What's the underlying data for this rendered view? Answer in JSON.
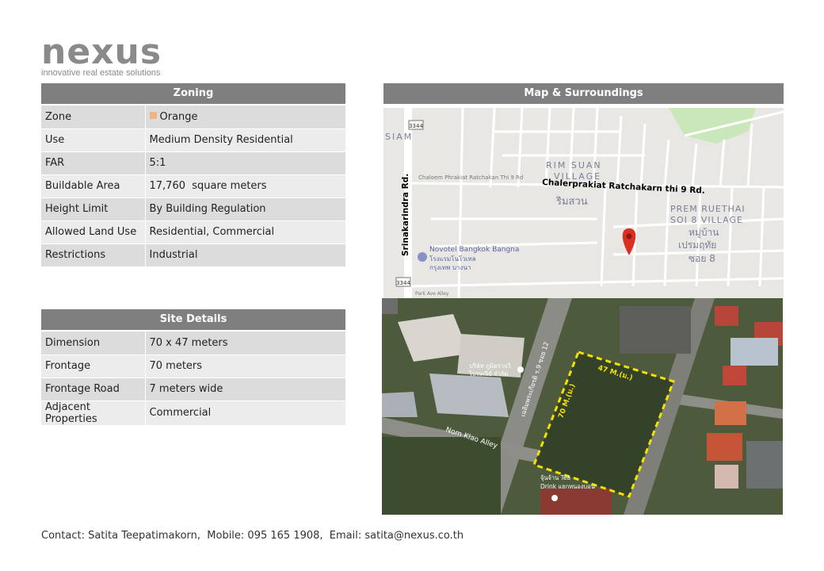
{
  "logo": {
    "word": "nexus",
    "tagline": "innovative real estate solutions"
  },
  "zoning": {
    "title": "Zoning",
    "rows": [
      {
        "key": "Zone",
        "value": "Orange"
      },
      {
        "key": "Use",
        "value": "Medium Density Residential"
      },
      {
        "key": "FAR",
        "value": "5:1"
      },
      {
        "key": "Buildable Area",
        "value": "17,760  square meters"
      },
      {
        "key": "Height Limit",
        "value": "By Building Regulation"
      },
      {
        "key": "Allowed Land Use",
        "value": "Residential, Commercial"
      },
      {
        "key": "Restrictions",
        "value": "Industrial"
      }
    ],
    "zone_color": "#f4b183"
  },
  "site": {
    "title": "Site Details",
    "rows": [
      {
        "key": "Dimension",
        "value": "70 x 47 meters"
      },
      {
        "key": "Frontage",
        "value": "70 meters"
      },
      {
        "key": "Frontage Road",
        "value": "7 meters wide"
      },
      {
        "key": "Adjacent Properties",
        "value": "Commercial"
      }
    ]
  },
  "map": {
    "title": "Map & Surroundings",
    "labels": {
      "srinakarindra": "Srinakarindra Rd.",
      "chalerprakiat": "Chalerprakiat  Ratchakarn  thi 9 Rd.",
      "chaloem_small": "Chaloem Phrakiat Ratchakan Thi 9 Rd",
      "rim_suan_1": "RIM SUAN",
      "rim_suan_2": "VILLAGE",
      "rim_suan_th": "ริมสวน",
      "prem_1": "PREM RUETHAI",
      "prem_2": "SOI 8 VILLAGE",
      "prem_th1": "หมู่บ้าน",
      "prem_th2": "เปรมฤทัย",
      "prem_th3": "ซอย 8",
      "novotel_1": "Novotel Bangkok Bangna",
      "novotel_2": "โรงแรมโนโวเทล",
      "novotel_3": "กรุงเทพ บางนา",
      "siam": "SIAM",
      "route1": "3344",
      "route2": "3344",
      "park": "Park Ave Alley"
    },
    "pin_color": "#d93025"
  },
  "satellite": {
    "labels": {
      "dim_47": "47 M.(ม.)",
      "dim_70": "70 M.(ม.)",
      "nom_klao": "Nom Klao Alley",
      "soi": "เฉลิมพระเกียรติ ร.9 ซอย 12",
      "poi1": "บริษัท ภูมิตรวจวิ",
      "poi2": "ไปรษณีย์ จำกัด",
      "poi3": "จุ้นจ้าน Tea",
      "poi4": "Drink แยกหนองบอน"
    },
    "outline_color": "#f5e000"
  },
  "footer": {
    "text": "Contact: Satita Teepatimakorn,  Mobile: 095 165 1908,  Email: satita@nexus.co.th"
  }
}
